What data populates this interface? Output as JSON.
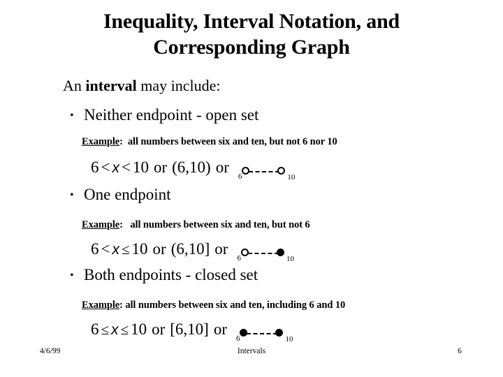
{
  "slide": {
    "title_line1": "Inequality, Interval Notation, and",
    "title_line2": "Corresponding Graph",
    "lead_prefix": "An ",
    "lead_bold": "interval",
    "lead_suffix": " may include:",
    "bullet_glyph": "•",
    "sections": [
      {
        "bullet": "Neither endpoint - open set",
        "example_label": "Example",
        "example_colon": ":",
        "example_text": "  all numbers between six and ten, but not 6 nor 10",
        "inequality": {
          "left_value": "6",
          "left_operator": "<",
          "variable": "x",
          "right_operator": "<",
          "right_value": "10"
        },
        "or_word": "or",
        "interval_notation": "(6,10)",
        "or_word2": "or",
        "graph": {
          "left_label": "6",
          "right_label": "10",
          "left_endpoint": "open",
          "right_endpoint": "open",
          "line_style": "dashed"
        }
      },
      {
        "bullet": "One endpoint",
        "example_label": "Example",
        "example_colon": ":",
        "example_text": "   all numbers between six and ten, but not 6",
        "inequality": {
          "left_value": "6",
          "left_operator": "<",
          "variable": "x",
          "right_operator": "≤",
          "right_value": "10"
        },
        "or_word": "or",
        "interval_notation": "(6,10]",
        "or_word2": "or",
        "graph": {
          "left_label": "6",
          "right_label": "10",
          "left_endpoint": "open",
          "right_endpoint": "closed",
          "line_style": "dashed"
        }
      },
      {
        "bullet": "Both endpoints - closed set",
        "example_label": "Example",
        "example_colon": ":",
        "example_text": " all numbers between six and ten, including 6 and 10",
        "inequality": {
          "left_value": "6",
          "left_operator": "≤",
          "variable": "x",
          "right_operator": "≤",
          "right_value": "10"
        },
        "or_word": "or",
        "interval_notation": "[6,10]",
        "or_word2": "or",
        "graph": {
          "left_label": "6",
          "right_label": "10",
          "left_endpoint": "closed",
          "right_endpoint": "closed",
          "line_style": "dashed"
        }
      }
    ]
  },
  "footer": {
    "date": "4/6/99",
    "center": "Intervals",
    "page_number": "6"
  },
  "colors": {
    "background": "#ffffff",
    "text": "#000000"
  }
}
